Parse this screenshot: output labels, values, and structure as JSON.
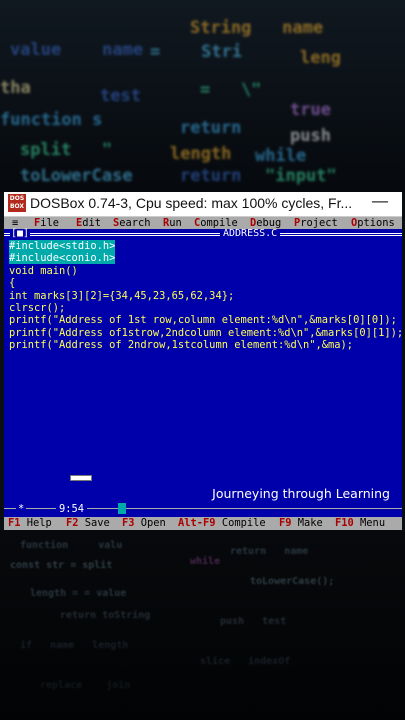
{
  "window": {
    "icon_text": "DOS BOX",
    "title": "DOSBox 0.74-3, Cpu speed: max 100% cycles, Fr...",
    "minimize_glyph": "—"
  },
  "menu": {
    "system": "≡",
    "items": [
      "File",
      "Edit",
      "Search",
      "Run",
      "Compile",
      "Debug",
      "Project",
      "Options"
    ]
  },
  "editor": {
    "window_number": "[■]",
    "filename": "ADDRESS.C",
    "code_lines": [
      "#include<stdio.h>",
      "#include<conio.h>",
      "void main()",
      "{",
      "int marks[3][2]={34,45,23,65,62,34};",
      "clrscr();",
      "printf(\"Address of 1st row,column element:%d\\n\",&marks[0][0]);",
      "printf(\"Address of1strow,2ndcolumn element:%d\\n\",&marks[0][1]);",
      "printf(\"Address of 2ndrow,1stcolumn element:%d\\n\",&ma);"
    ],
    "status_star": "*",
    "cursor_position": "9:54"
  },
  "watermark": "Journeying through Learning",
  "function_keys": [
    {
      "key": "F1",
      "label": "Help"
    },
    {
      "key": "F2",
      "label": "Save"
    },
    {
      "key": "F3",
      "label": "Open"
    },
    {
      "key": "Alt-F9",
      "label": "Compile"
    },
    {
      "key": "F9",
      "label": "Make"
    },
    {
      "key": "F10",
      "label": "Menu"
    }
  ],
  "colors": {
    "editor_bg": "#0000aa",
    "code_text": "#ffff55",
    "selection": "#00aaaa",
    "menu_bg": "#aaaaaa",
    "hotkey": "#aa0000"
  }
}
